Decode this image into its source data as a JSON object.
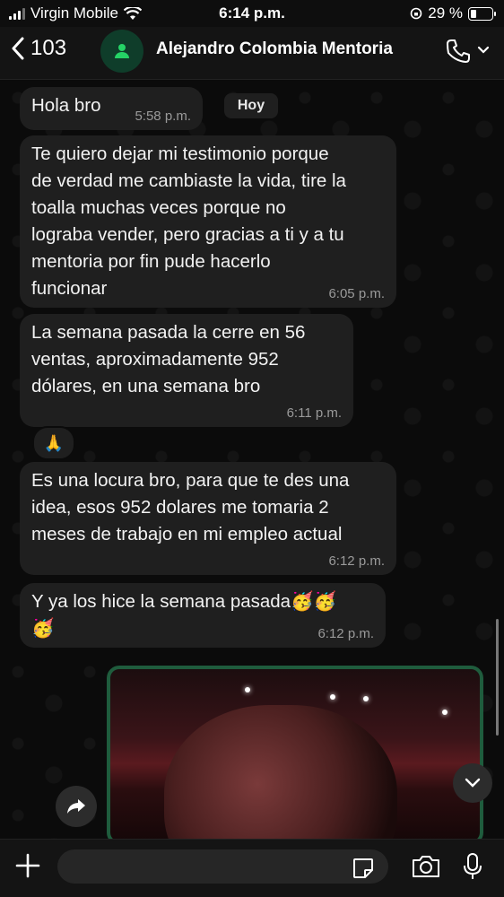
{
  "status_bar": {
    "carrier": "Virgin Mobile",
    "time": "6:14 p.m.",
    "battery": "29 %"
  },
  "header": {
    "back_count": "103",
    "contact_name": "Alejandro Colombia Mentoria"
  },
  "date_chip": "Hoy",
  "messages": [
    {
      "text": "Hola bro",
      "time": "5:58 p.m."
    },
    {
      "text": "Te quiero dejar mi testimonio porque\nde verdad me cambiaste la vida, tire la\ntoalla muchas veces porque no\nlograba vender, pero gracias a ti y a tu\nmentoria por fin pude hacerlo\nfuncionar",
      "time": "6:05 p.m."
    },
    {
      "text": "La semana pasada la cerre en 56\nventas, aproximadamente 952\ndólares, en una semana bro",
      "time": "6:11 p.m.",
      "reaction": "🙏"
    },
    {
      "text": "Es una locura bro, para que te des una\nidea, esos 952 dolares me tomaria 2\nmeses de trabajo en mi empleo actual",
      "time": "6:12 p.m."
    },
    {
      "text": "Y ya los hice la semana pasada🥳🥳\n🥳",
      "time": "6:12 p.m."
    }
  ],
  "colors": {
    "background": "#0b0b0b",
    "bubble": "#1f1f1f",
    "accent_green": "#1f5c3d",
    "avatar_icon": "#25d366"
  }
}
